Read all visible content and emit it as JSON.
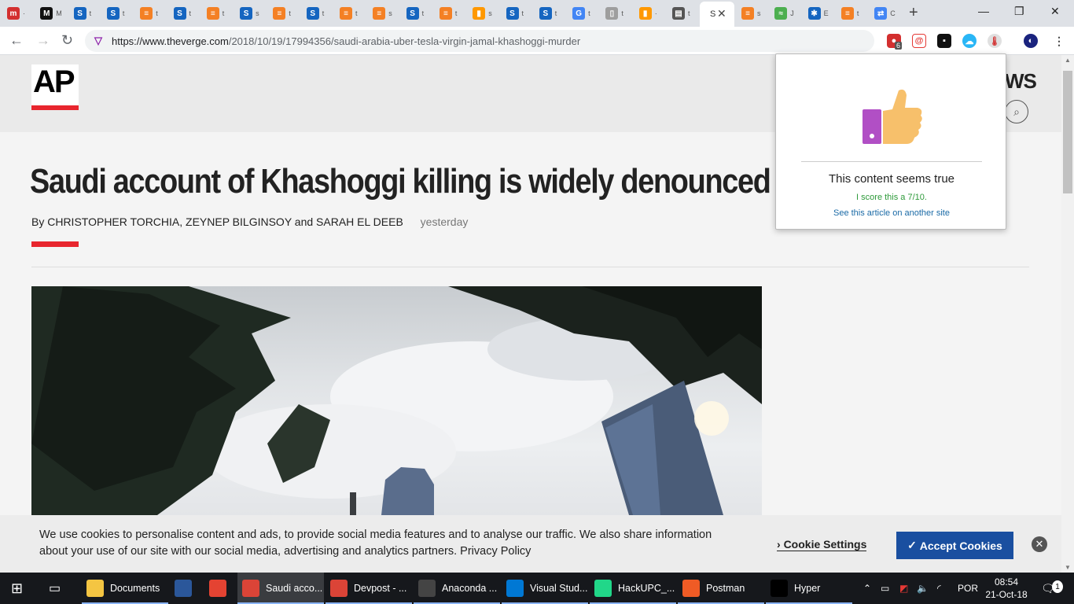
{
  "browser": {
    "tabs": [
      {
        "icon": "magazine-red-icon",
        "color": "#d32f2f",
        "glyph": "m",
        "label": "·"
      },
      {
        "icon": "medium-icon",
        "color": "#111111",
        "glyph": "M",
        "label": "M"
      },
      {
        "icon": "scholar-s-icon",
        "color": "#1565c0",
        "glyph": "S",
        "label": "t"
      },
      {
        "icon": "scholar-s-icon",
        "color": "#1565c0",
        "glyph": "S",
        "label": "t"
      },
      {
        "icon": "stackoverflow-icon",
        "color": "#f48024",
        "glyph": "≡",
        "label": "t"
      },
      {
        "icon": "scholar-s-icon",
        "color": "#1565c0",
        "glyph": "S",
        "label": "t"
      },
      {
        "icon": "stackoverflow-icon",
        "color": "#f48024",
        "glyph": "≡",
        "label": "t"
      },
      {
        "icon": "scholar-s-icon",
        "color": "#1565c0",
        "glyph": "S",
        "label": "s"
      },
      {
        "icon": "stackoverflow-icon",
        "color": "#f48024",
        "glyph": "≡",
        "label": "t"
      },
      {
        "icon": "scholar-s-icon",
        "color": "#1565c0",
        "glyph": "S",
        "label": "t"
      },
      {
        "icon": "stackoverflow-icon",
        "color": "#f48024",
        "glyph": "≡",
        "label": "t"
      },
      {
        "icon": "stackoverflow-icon",
        "color": "#f48024",
        "glyph": "≡",
        "label": "s"
      },
      {
        "icon": "scholar-s-icon",
        "color": "#1565c0",
        "glyph": "S",
        "label": "t"
      },
      {
        "icon": "stackoverflow-icon",
        "color": "#f48024",
        "glyph": "≡",
        "label": "t"
      },
      {
        "icon": "chart-icon",
        "color": "#ff9800",
        "glyph": "▮",
        "label": "s"
      },
      {
        "icon": "scholar-s-icon",
        "color": "#1565c0",
        "glyph": "S",
        "label": "t"
      },
      {
        "icon": "scholar-s-icon",
        "color": "#1565c0",
        "glyph": "S",
        "label": "t"
      },
      {
        "icon": "google-icon",
        "color": "#4285f4",
        "glyph": "G",
        "label": "t"
      },
      {
        "icon": "document-icon",
        "color": "#9e9e9e",
        "glyph": "▯",
        "label": "t"
      },
      {
        "icon": "chart-icon",
        "color": "#ff9800",
        "glyph": "▮",
        "label": "·"
      },
      {
        "icon": "reader-icon",
        "color": "#555555",
        "glyph": "▤",
        "label": "t"
      }
    ],
    "active_tab": {
      "label": "S"
    },
    "tabs_after": [
      {
        "icon": "stackoverflow-icon",
        "color": "#f48024",
        "glyph": "≡",
        "label": "s"
      },
      {
        "icon": "wolfram-icon",
        "color": "#4caf50",
        "glyph": "≈",
        "label": "J"
      },
      {
        "icon": "puzzle-icon",
        "color": "#1565c0",
        "glyph": "✱",
        "label": "E"
      },
      {
        "icon": "stackoverflow-icon",
        "color": "#f48024",
        "glyph": "≡",
        "label": "t"
      },
      {
        "icon": "translate-icon",
        "color": "#4285f4",
        "glyph": "⇄",
        "label": "C"
      }
    ],
    "url_host": "https://www.theverge.com",
    "url_path": "/2018/10/19/17994356/saudi-arabia-uber-tesla-virgin-jamal-khashoggi-murder",
    "extension_badge": "6"
  },
  "page": {
    "logo": "AP",
    "nav_fragment": "WS",
    "headline": "Saudi account of Khashoggi killing is widely denounced",
    "byline": "By CHRISTOPHER TORCHIA, ZEYNEP BILGINSOY and SARAH EL DEEB",
    "published": "yesterday"
  },
  "popup": {
    "verdict": "This content seems true",
    "score": "I score this a 7/10.",
    "other_link": "See this article on another site",
    "colors": {
      "accent": "#b14fc5",
      "thumb": "#f7c06b",
      "score": "#2e9a3a"
    }
  },
  "cookie_banner": {
    "message": "We use cookies to personalise content and ads, to provide social media features and to analyse our traffic. We also share information about your use of our site with our social media, advertising and analytics partners. Privacy Policy",
    "settings_label": "Cookie Settings",
    "accept_label": "Accept Cookies",
    "settings_glyph": "›",
    "accept_glyph": "✓"
  },
  "taskbar": {
    "items": [
      {
        "label": "Documents",
        "icon": "file-explorer-icon",
        "color": "#f4c542"
      },
      {
        "label": "",
        "icon": "word-icon",
        "color": "#2b579a"
      },
      {
        "label": "",
        "icon": "todoist-icon",
        "color": "#e44332"
      },
      {
        "label": "Saudi acco...",
        "icon": "chrome-icon",
        "color": "#db4437",
        "active": true
      },
      {
        "label": "Devpost - ...",
        "icon": "chrome-icon",
        "color": "#db4437"
      },
      {
        "label": "Anaconda ...",
        "icon": "terminal-icon",
        "color": "#444444"
      },
      {
        "label": "Visual Stud...",
        "icon": "vscode-icon",
        "color": "#0078d4"
      },
      {
        "label": "HackUPC_...",
        "icon": "pycharm-icon",
        "color": "#21d789"
      },
      {
        "label": "Postman",
        "icon": "postman-icon",
        "color": "#ef5b25"
      },
      {
        "label": "Hyper",
        "icon": "hyper-terminal-icon",
        "color": "#000000"
      }
    ],
    "language": "POR",
    "time": "08:54",
    "date": "21-Oct-18",
    "notifications": "1"
  }
}
